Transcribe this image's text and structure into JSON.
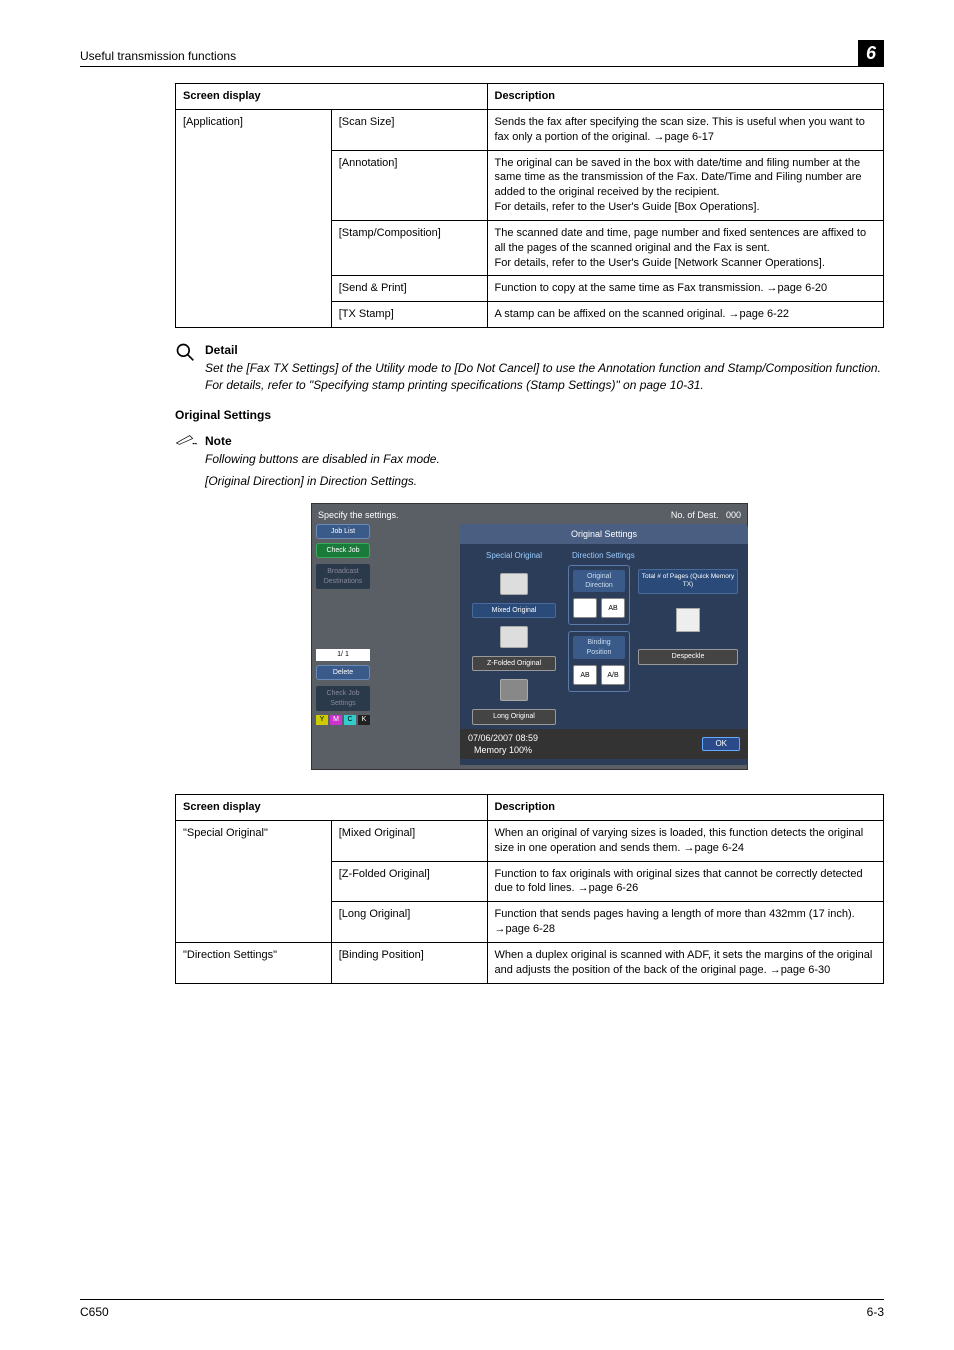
{
  "header": {
    "left": "Useful transmission functions",
    "chapter": "6"
  },
  "table1": {
    "head": [
      "Screen display",
      "Description"
    ],
    "group": "[Application]",
    "rows": [
      {
        "label": "[Scan Size]",
        "desc": "Sends the fax after specifying the scan size. This is useful when you want to fax only a portion of the original. →page 6-17"
      },
      {
        "label": "[Annotation]",
        "desc": "The original can be saved in the box with date/time and filing number at the same time as the transmission of the Fax. Date/Time and Filing number are added to the original received by the recipient.\nFor details, refer to the User's Guide [Box Operations]."
      },
      {
        "label": "[Stamp/Composition]",
        "desc": "The scanned date and time, page number and fixed sentences are affixed to all the pages of the scanned original and the Fax is sent.\nFor details, refer to the User's Guide [Network Scanner Operations]."
      },
      {
        "label": "[Send & Print]",
        "desc": "Function to copy at the same time as Fax transmission. →page 6-20"
      },
      {
        "label": "[TX Stamp]",
        "desc": "A stamp can be affixed on the scanned original. →page 6-22"
      }
    ]
  },
  "detail": {
    "title": "Detail",
    "body": "Set the [Fax TX Settings] of the Utility mode to [Do Not Cancel] to use the Annotation function and Stamp/Composition function. For details, refer to \"Specifying stamp printing specifications (Stamp Settings)\" on page 10-31."
  },
  "section": {
    "title": "Original Settings"
  },
  "note": {
    "title": "Note",
    "lines": [
      "Following buttons are disabled in Fax mode.",
      "[Original Direction] in Direction Settings."
    ]
  },
  "screenshot": {
    "specify": "Specify the settings.",
    "no_of": "No. of Dest.",
    "no_of_val": "000",
    "job_list": "Job List",
    "check_job": "Check Job",
    "broadcast": "Broadcast Destinations",
    "page": "1/ 1",
    "delete": "Delete",
    "check_setting": "Check Job Settings",
    "toner": [
      "Y",
      "M",
      "C",
      "K"
    ],
    "datetime": "07/06/2007    08:59",
    "memory": "Memory        100%",
    "panel_title": "Original Settings",
    "special": "Special Original",
    "mixed": "Mixed Original",
    "zfold": "Z-Folded Original",
    "long": "Long Original",
    "dir_settings": "Direction Settings",
    "orig_dir": "Original Direction",
    "binding": "Binding Position",
    "total": "Total # of Pages (Quick Memory TX)",
    "despeckle": "Despeckle",
    "ok": "OK"
  },
  "table2": {
    "head": [
      "Screen display",
      "Description"
    ],
    "rows": [
      {
        "group": "\"Special Original\"",
        "label": "[Mixed Original]",
        "desc": "When an original of varying sizes is loaded, this function detects the original size in one operation and sends them. →page 6-24"
      },
      {
        "group": "",
        "label": "[Z-Folded Original]",
        "desc": "Function to fax originals with original sizes that cannot be correctly detected due to fold lines. →page 6-26"
      },
      {
        "group": "",
        "label": "[Long Original]",
        "desc": "Function that sends pages having a length of more than 432mm (17 inch). →page 6-28"
      },
      {
        "group": "\"Direction Settings\"",
        "label": "[Binding Position]",
        "desc": "When a duplex original is scanned with ADF, it sets the margins of the original and adjusts the position of the back of the original page. →page 6-30"
      }
    ]
  },
  "footer": {
    "left": "C650",
    "right": "6-3"
  }
}
